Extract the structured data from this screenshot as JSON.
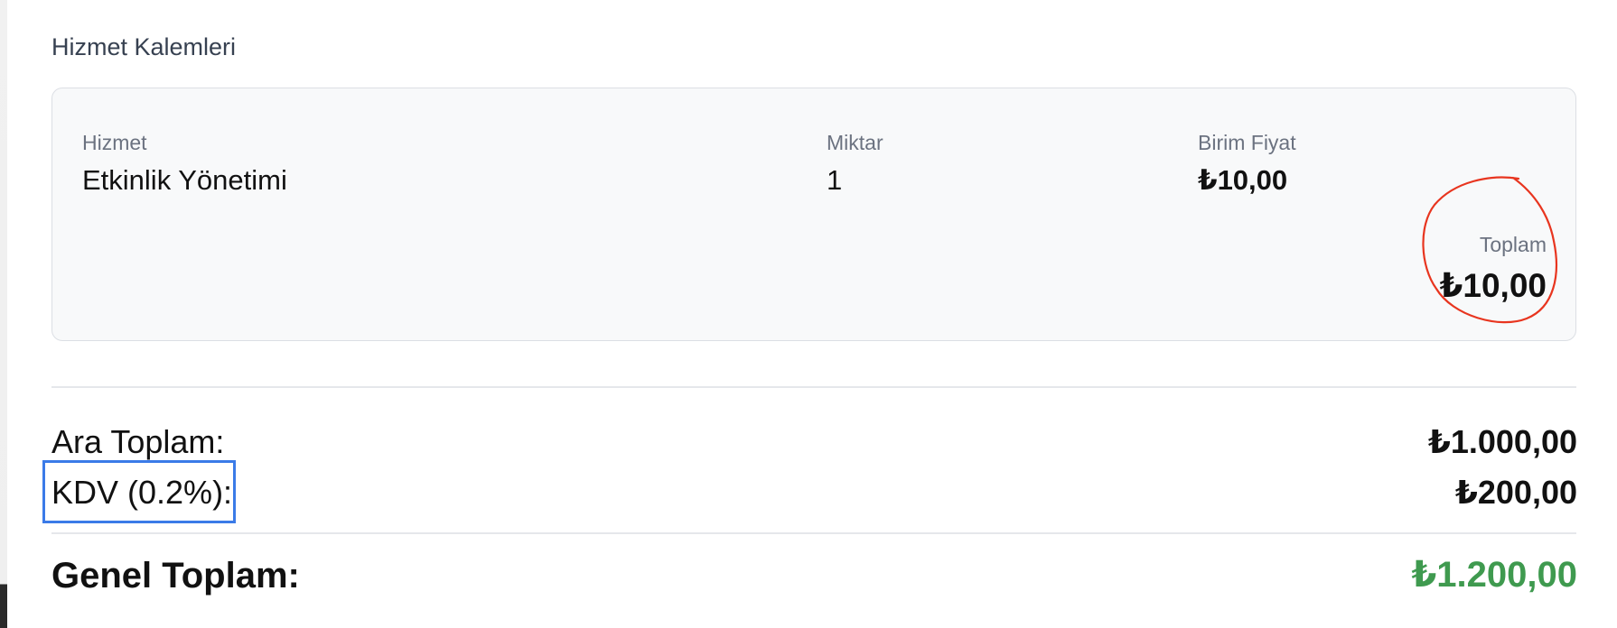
{
  "section": {
    "title": "Hizmet Kalemleri"
  },
  "line_item": {
    "service_label": "Hizmet",
    "service_value": "Etkinlik Yönetimi",
    "quantity_label": "Miktar",
    "quantity_value": "1",
    "unit_price_label": "Birim Fiyat",
    "unit_price_value": "₺10,00",
    "total_label": "Toplam",
    "total_value": "₺10,00"
  },
  "summary": {
    "subtotal_label": "Ara Toplam:",
    "subtotal_value": "₺1.000,00",
    "vat_label": "KDV (0.2%):",
    "vat_value": "₺200,00",
    "grand_total_label": "Genel Toplam:",
    "grand_total_value": "₺1.200,00"
  },
  "colors": {
    "grand_total": "#3f9a4f",
    "annotation_circle": "#e8351f",
    "annotation_box": "#3b7be8"
  }
}
